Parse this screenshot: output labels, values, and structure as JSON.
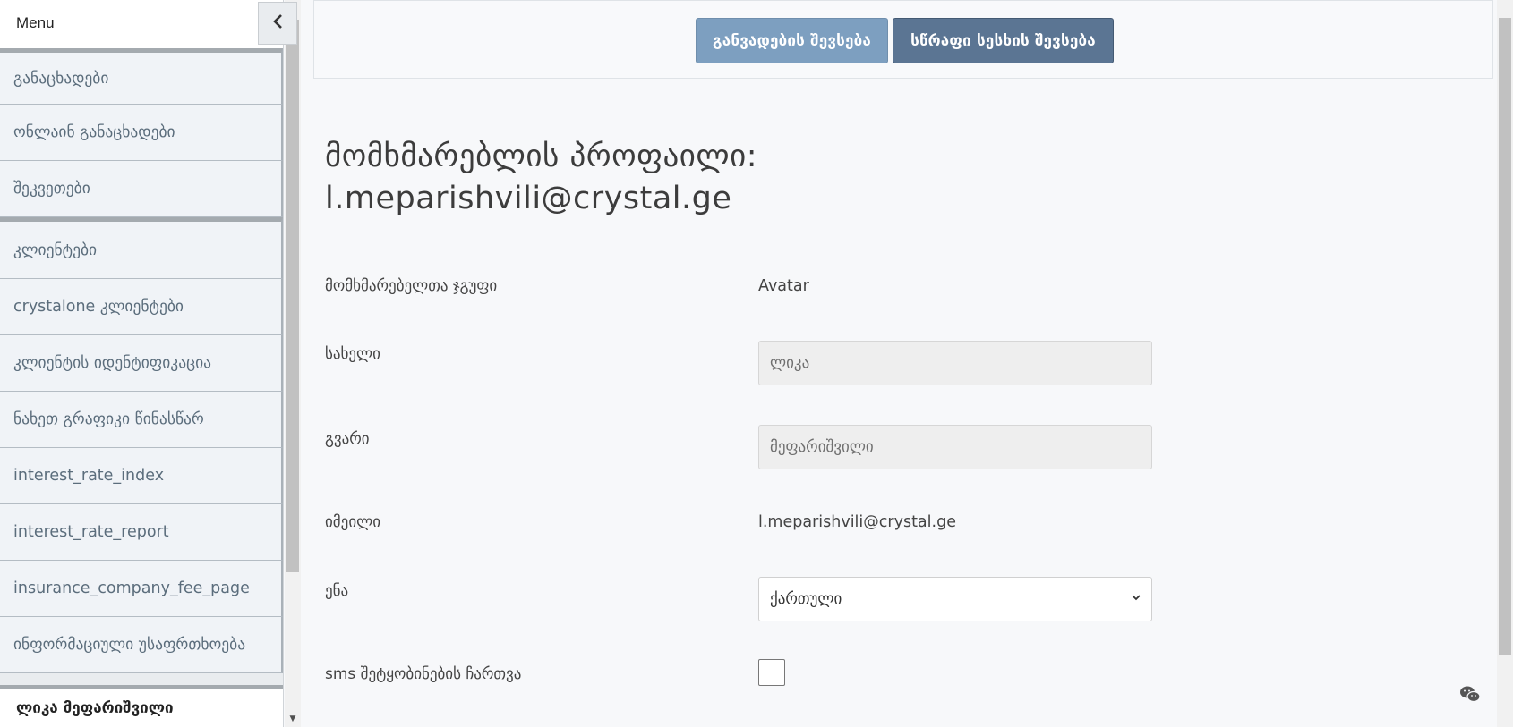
{
  "sidebar": {
    "title": "Menu",
    "items": [
      {
        "label": "განაცხადები"
      },
      {
        "label": "ონლაინ განაცხადები"
      },
      {
        "label": "შეკვეთები"
      },
      {
        "label": "კლიენტები"
      },
      {
        "label": "crystalone კლიენტები"
      },
      {
        "label": "კლიენტის იდენტიფიკაცია"
      },
      {
        "label": "ნახეთ გრაფიკი წინასწარ"
      },
      {
        "label": "interest_rate_index"
      },
      {
        "label": "interest_rate_report"
      },
      {
        "label": "insurance_company_fee_page"
      },
      {
        "label": "ინფორმაციული უსაფრთხოება"
      }
    ],
    "user": "ლიკა მეფარიშვილი"
  },
  "topbar": {
    "dev_button": "განვადების შევსება",
    "quick_button": "სწრაფი სესხის შევსება"
  },
  "profile": {
    "title_line1": "მომხმარებლის პროფაილი:",
    "title_line2": "l.meparishvili@crystal.ge",
    "group_label": "მომხმარებელთა ჯგუფი",
    "group_value": "Avatar",
    "name_label": "სახელი",
    "name_value": "ლიკა",
    "surname_label": "გვარი",
    "surname_value": "მეფარიშვილი",
    "email_label": "იმეილი",
    "email_value": "l.meparishvili@crystal.ge",
    "language_label": "ენა",
    "language_value": "ქართული",
    "sms_label": "sms შეტყობინების ჩართვა",
    "sms_enabled": false
  }
}
